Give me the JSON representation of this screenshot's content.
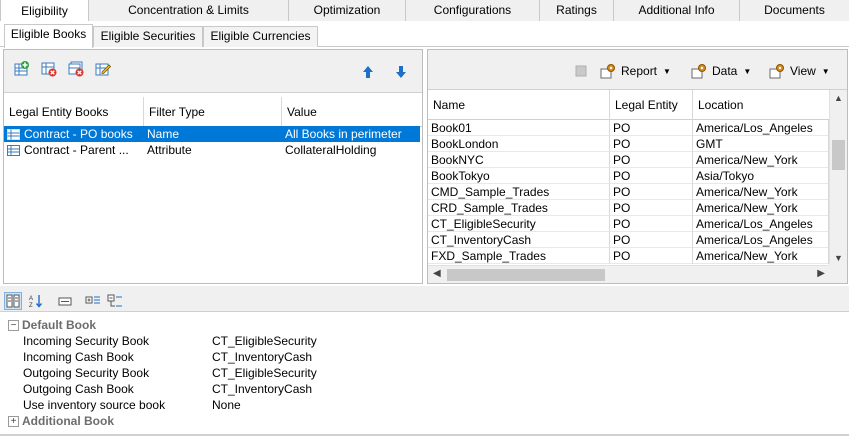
{
  "main_tabs": [
    {
      "label": "Eligibility"
    },
    {
      "label": "Concentration & Limits"
    },
    {
      "label": "Optimization"
    },
    {
      "label": "Configurations"
    },
    {
      "label": "Ratings"
    },
    {
      "label": "Additional Info"
    },
    {
      "label": "Documents"
    }
  ],
  "sub_tabs": [
    {
      "label": "Eligible Books"
    },
    {
      "label": "Eligible Securities"
    },
    {
      "label": "Eligible Currencies"
    }
  ],
  "left_grid": {
    "columns": [
      "Legal Entity Books",
      "Filter Type",
      "Value"
    ],
    "rows": [
      {
        "book": "Contract - PO books",
        "filter_type": "Name",
        "value": "All Books in perimeter"
      },
      {
        "book": "Contract - Parent ...",
        "filter_type": "Attribute",
        "value": "CollateralHolding"
      }
    ]
  },
  "right_toolbar": {
    "report": "Report",
    "data": "Data",
    "view": "View"
  },
  "right_grid": {
    "columns": [
      "Name",
      "Legal Entity",
      "Location"
    ],
    "rows": [
      {
        "name": "Book01",
        "entity": "PO",
        "location": "America/Los_Angeles"
      },
      {
        "name": "BookLondon",
        "entity": "PO",
        "location": "GMT"
      },
      {
        "name": "BookNYC",
        "entity": "PO",
        "location": "America/New_York"
      },
      {
        "name": "BookTokyo",
        "entity": "PO",
        "location": "Asia/Tokyo"
      },
      {
        "name": "CMD_Sample_Trades",
        "entity": "PO",
        "location": "America/New_York"
      },
      {
        "name": "CRD_Sample_Trades",
        "entity": "PO",
        "location": "America/New_York"
      },
      {
        "name": "CT_EligibleSecurity",
        "entity": "PO",
        "location": "America/Los_Angeles"
      },
      {
        "name": "CT_InventoryCash",
        "entity": "PO",
        "location": "America/Los_Angeles"
      },
      {
        "name": "FXD_Sample_Trades",
        "entity": "PO",
        "location": "America/New_York"
      }
    ]
  },
  "property_grid": {
    "default_book": {
      "label": "Default Book",
      "props": [
        {
          "name": "Incoming Security Book",
          "value": "CT_EligibleSecurity"
        },
        {
          "name": "Incoming Cash Book",
          "value": "CT_InventoryCash"
        },
        {
          "name": "Outgoing Security Book",
          "value": "CT_EligibleSecurity"
        },
        {
          "name": "Outgoing Cash Book",
          "value": "CT_InventoryCash"
        },
        {
          "name": "Use inventory source book",
          "value": "None"
        }
      ]
    },
    "additional_book": {
      "label": "Additional Book"
    }
  },
  "icons": {
    "add": "add-book-icon",
    "remove": "remove-book-icon",
    "remove_all": "remove-all-icon",
    "edit": "edit-icon",
    "up": "move-up-icon",
    "down": "move-down-icon",
    "report": "report-gear-icon",
    "data": "data-gear-icon",
    "view": "view-gear-icon"
  },
  "colors": {
    "selection": "#0078d7",
    "arrow_blue": "#1e6fc9",
    "gear_orange": "#d88c1c"
  }
}
